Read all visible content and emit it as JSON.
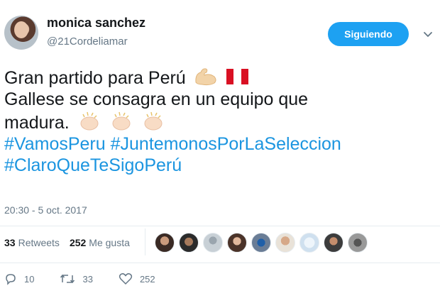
{
  "user": {
    "display_name": "monica sanchez",
    "handle": "@21Cordeliamar"
  },
  "follow_button": {
    "label": "Siguiendo"
  },
  "tweet": {
    "line1": "Gran partido para Perú",
    "line2": "Gallese se consagra en un equipo que",
    "line3": "madura.",
    "hashtag1": "#VamosPeru",
    "hashtag2": "#JuntemonosPorLaSeleccion",
    "hashtag3": "#ClaroQueTeSigoPerú"
  },
  "timestamp": "20:30 - 5 oct. 2017",
  "stats": {
    "retweets_count": "33",
    "retweets_label": "Retweets",
    "likes_count": "252",
    "likes_label": "Me gusta"
  },
  "actions": {
    "reply_count": "10",
    "retweet_count": "33",
    "like_count": "252"
  },
  "colors": {
    "accent": "#1da1f2",
    "hashtag": "#1b95e0",
    "muted": "#657786",
    "text": "#14171a"
  },
  "icons": [
    "chevron-down-icon",
    "flexed-biceps-emoji",
    "peru-flag-emoji",
    "clapping-hands-emoji",
    "reply-icon",
    "retweet-icon",
    "heart-icon"
  ]
}
